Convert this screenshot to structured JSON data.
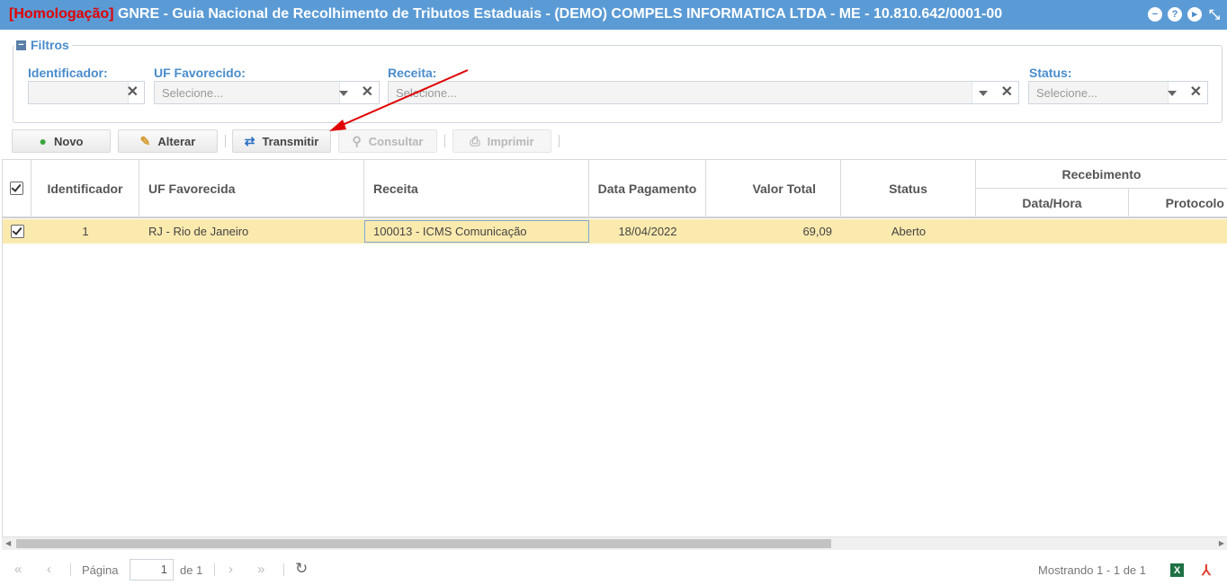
{
  "window": {
    "env_tag": "[Homologação]",
    "title": "GNRE - Guia Nacional de Recolhimento de Tributos Estaduais - (DEMO) COMPELS INFORMATICA LTDA - ME - 10.810.642/0001-00",
    "icons": [
      "minimize-circle-icon",
      "help-icon",
      "play-icon",
      "collapse-icon"
    ]
  },
  "filters": {
    "legend": "Filtros",
    "identificador": {
      "label": "Identificador:",
      "value": ""
    },
    "uf": {
      "label": "UF Favorecido:",
      "placeholder": "Selecione..."
    },
    "receita": {
      "label": "Receita:",
      "placeholder": "Selecione..."
    },
    "status": {
      "label": "Status:",
      "placeholder": "Selecione..."
    }
  },
  "toolbar": {
    "novo": "Novo",
    "alterar": "Alterar",
    "transmitir": "Transmitir",
    "consultar": "Consultar",
    "imprimir": "Imprimir"
  },
  "grid": {
    "columns": {
      "identificador": "Identificador",
      "uf": "UF Favorecida",
      "receita": "Receita",
      "data_pagamento": "Data Pagamento",
      "valor_total": "Valor Total",
      "status": "Status",
      "recebimento": "Recebimento",
      "data_hora": "Data/Hora",
      "protocolo": "Protocolo"
    },
    "rows": [
      {
        "identificador": "1",
        "uf": "RJ - Rio de Janeiro",
        "receita": "100013 - ICMS Comunicação",
        "data_pagamento": "18/04/2022",
        "valor_total": "69,09",
        "status": "Aberto",
        "data_hora": "",
        "protocolo": ""
      }
    ]
  },
  "pager": {
    "page_label": "Página",
    "page_value": "1",
    "of_label": "de 1",
    "showing": "Mostrando 1 - 1 de 1"
  },
  "colors": {
    "titlebar": "#5b9bd5",
    "env_tag": "#e10000",
    "selected_row": "#fbeaae",
    "annotation_arrow": "#e00000"
  }
}
